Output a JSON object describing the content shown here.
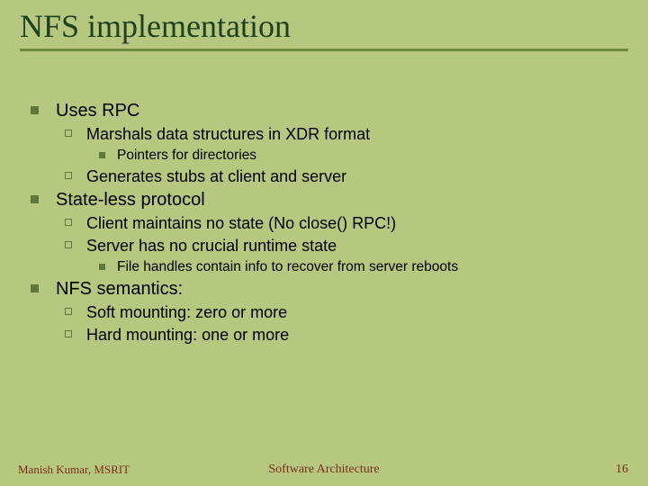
{
  "title": "NFS implementation",
  "bullets": {
    "uses_rpc": "Uses RPC",
    "marshals": "Marshals data structures in XDR format",
    "pointers": "Pointers for directories",
    "generates": "Generates stubs at client and server",
    "stateless": "State-less protocol",
    "client_maintains": "Client maintains no state (No close() RPC!)",
    "server_no": "Server has no crucial runtime state",
    "file_handles": "File handles contain info to recover from server reboots",
    "nfs_semantics": "NFS semantics:",
    "soft": "Soft mounting: zero or more",
    "hard": "Hard mounting: one or more"
  },
  "footer": {
    "left": "Manish Kumar, MSRIT",
    "center": "Software Architecture",
    "right": "16"
  }
}
